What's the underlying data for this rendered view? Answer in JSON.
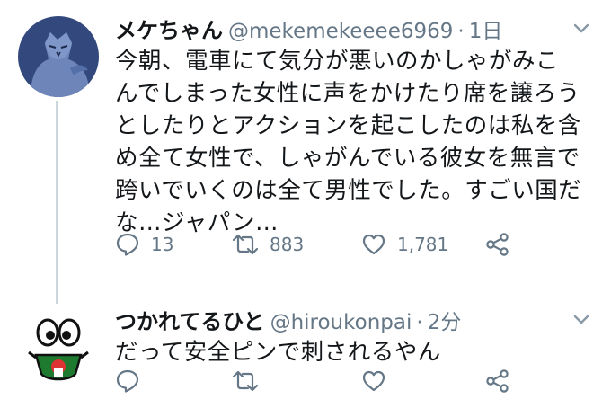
{
  "tweets": [
    {
      "display_name": "メケちゃん",
      "handle": "@mekemekeeee6969",
      "separator": "·",
      "time": "1日",
      "text": "今朝、電車にて気分が悪いのかしゃがみこんでしまった女性に声をかけたり席を譲ろうとしたりとアクションを起こしたのは私を含め全て女性で、しゃがんでいる彼女を無言で跨いでいくのは全て男性でした。すごい国だな…ジャパン…",
      "replies": "13",
      "retweets": "883",
      "likes": "1,781"
    },
    {
      "display_name": "つかれてるひと",
      "handle": "@hiroukonpai",
      "separator": "·",
      "time": "2分",
      "text": "だって安全ピンで刺されるやん",
      "replies": "",
      "retweets": "",
      "likes": ""
    }
  ],
  "colors": {
    "secondary_text": "#657786",
    "thread_line": "#ccd6dd",
    "avatar1_bg": "#3a4f83"
  },
  "icons": [
    "reply-icon",
    "retweet-icon",
    "like-icon",
    "share-icon",
    "caret-down-icon"
  ]
}
